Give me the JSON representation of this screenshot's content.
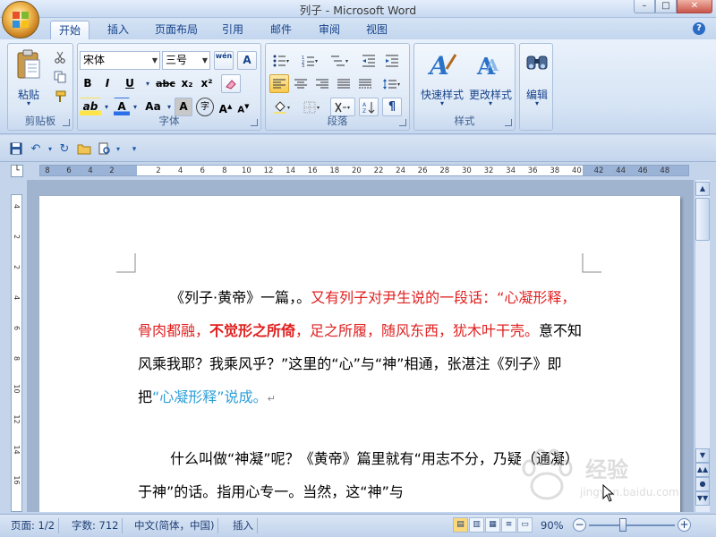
{
  "window": {
    "title": "列子 - Microsoft Word",
    "controls": {
      "minimize": "–",
      "maximize": "□",
      "close": "✕"
    }
  },
  "tabs": [
    {
      "label": "开始",
      "active": true
    },
    {
      "label": "插入"
    },
    {
      "label": "页面布局"
    },
    {
      "label": "引用"
    },
    {
      "label": "邮件"
    },
    {
      "label": "审阅"
    },
    {
      "label": "视图"
    }
  ],
  "help_glyph": "?",
  "ribbon": {
    "clipboard": {
      "label": "剪贴板",
      "paste": "粘贴"
    },
    "font": {
      "label": "字体",
      "font_name": "宋体",
      "font_size": "三号",
      "wen_icon_text": "wén",
      "bold": "B",
      "italic": "I",
      "underline": "U",
      "strike": "abc",
      "subscript": "x₂",
      "superscript": "x²",
      "highlight": "ab",
      "font_color": "A",
      "case": "Aa",
      "char_shade": "A",
      "enclose": "字",
      "grow": "A",
      "shrink": "A",
      "clear": "A"
    },
    "paragraph": {
      "label": "段落"
    },
    "styles": {
      "label": "样式",
      "quick": "快速样式",
      "change": "更改样式"
    },
    "editing": {
      "label": "编辑"
    }
  },
  "ruler": {
    "h_ticks": [
      "8",
      "6",
      "4",
      "2",
      "2",
      "4",
      "6",
      "8",
      "10",
      "12",
      "14",
      "16",
      "18",
      "20",
      "22",
      "24",
      "26",
      "28",
      "30",
      "32",
      "34",
      "36",
      "38",
      "40",
      "42",
      "44",
      "46",
      "48"
    ],
    "v_ticks": [
      "4",
      "2",
      "2",
      "4",
      "6",
      "8",
      "10",
      "12",
      "14",
      "16"
    ]
  },
  "document": {
    "p1": [
      {
        "text": "《列子·黄帝》一篇，。",
        "style": "normal"
      },
      {
        "text": "又有列子对尹生说的一段话：“心凝形释，骨肉都融，",
        "style": "red"
      },
      {
        "text": "不觉形之所倚",
        "style": "redb"
      },
      {
        "text": "，足之所履，随风东西，犹木叶干壳。",
        "style": "red"
      },
      {
        "text": "意不知风乘我耶？我乘风乎？”这里的“心”与“神”相通，张湛注《列子》即把",
        "style": "normal"
      },
      {
        "text": "“心凝形释”说成。",
        "style": "blue"
      },
      {
        "text": "↵",
        "style": "mark"
      }
    ],
    "p2": "什么叫做“神凝”呢？《黄帝》篇里就有“用志不分，乃疑（通凝）于神”的话。指用心专一。当然，这“神”与"
  },
  "watermark": {
    "text": "经验",
    "url": "jingyan.baidu.com"
  },
  "status": {
    "page": "页面: 1/2",
    "words": "字数: 712",
    "language": "中文(简体，中国)",
    "mode": "插入",
    "zoom": "90%",
    "zoom_minus": "−",
    "zoom_plus": "+"
  }
}
